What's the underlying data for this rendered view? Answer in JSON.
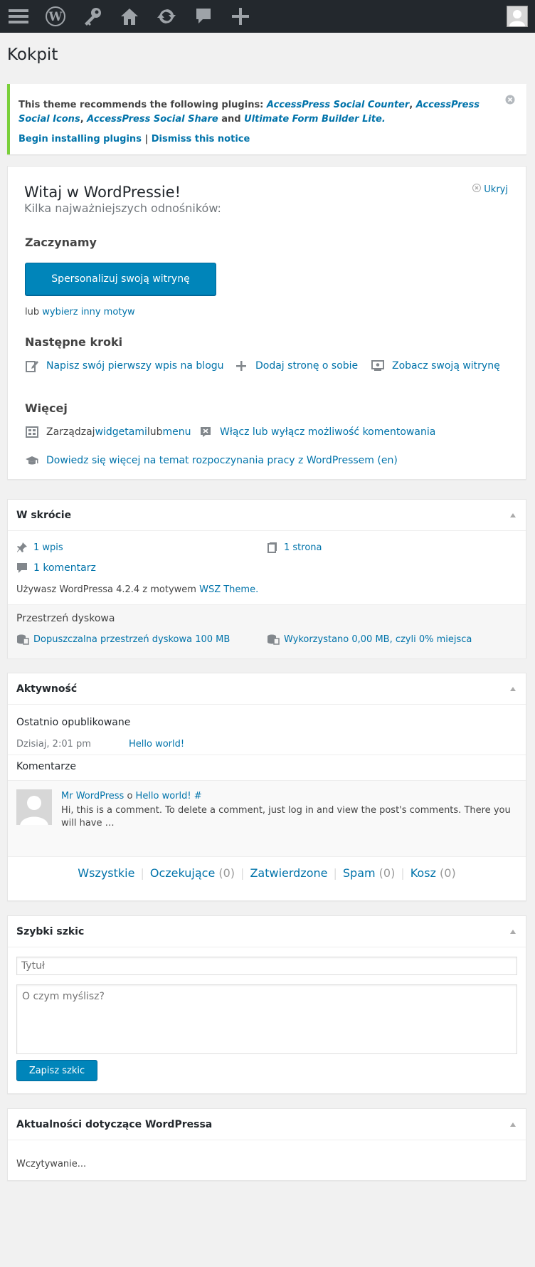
{
  "colors": {
    "adminbar": "#23282d",
    "accent": "#0073aa",
    "primary_button": "#0085ba",
    "notice_border": "#7ad03a"
  },
  "adminbar": {
    "items": [
      "menu-icon",
      "wordpress-logo-icon",
      "key-icon",
      "home-icon",
      "updates-icon",
      "comments-icon",
      "plus-icon"
    ],
    "avatar": "user-avatar"
  },
  "page": {
    "title": "Kokpit"
  },
  "notice": {
    "text_prefix": "This theme recommends the following plugins: ",
    "plugins": [
      "AccessPress Social Counter",
      "AccessPress Social Icons",
      "AccessPress Social Share",
      "Ultimate Form Builder Lite."
    ],
    "sep_comma": ", ",
    "and": " and ",
    "install_link": "Begin installing plugins",
    "divider": " | ",
    "dismiss_link": "Dismiss this notice"
  },
  "welcome": {
    "title": "Witaj w WordPressie!",
    "about": "Kilka najważniejszych odnośników:",
    "dismiss": "Ukryj",
    "get_started": "Zaczynamy",
    "customize_button": "Spersonalizuj swoją witrynę",
    "or": "lub ",
    "choose_theme": "wybierz inny motyw",
    "next_steps": "Następne kroki",
    "write_post": "Napisz swój pierwszy wpis na blogu",
    "add_about": "Dodaj stronę o sobie",
    "view_site": "Zobacz swoją witrynę",
    "more": "Więcej",
    "manage": "Zarządzaj ",
    "widgets": "widgetami",
    "or_word": " lub ",
    "menus": "menu",
    "comments_toggle": "Włącz lub wyłącz możliwość komentowania",
    "learn_more": "Dowiedz się więcej na temat rozpoczynania pracy z WordPressem (en)"
  },
  "glance": {
    "title": "W skrócie",
    "posts": "1 wpis",
    "pages": "1 strona",
    "comments": "1 komentarz",
    "version_text": "Używasz WordPressa 4.2.4 z motywem ",
    "theme_link": "WSZ Theme.",
    "disk_title": "Przestrzeń dyskowa",
    "disk_allowed": "Dopuszczalna przestrzeń dyskowa 100 MB",
    "disk_used": "Wykorzystano 0,00 MB, czyli 0% miejsca"
  },
  "activity": {
    "title": "Aktywność",
    "recent_title": "Ostatnio opublikowane",
    "recent_date": "Dzisiaj, 2:01 pm",
    "recent_post": "Hello world!",
    "comments_title": "Komentarze",
    "comment_author": "Mr WordPress",
    "comment_on": " o ",
    "comment_post": "Hello world! #",
    "comment_text": "Hi, this is a comment. To delete a comment, just log in and view the post's comments. There you will have …",
    "filters": [
      {
        "label": "Wszystkie",
        "count": ""
      },
      {
        "label": "Oczekujące",
        "count": "(0)"
      },
      {
        "label": "Zatwierdzone",
        "count": ""
      },
      {
        "label": "Spam",
        "count": "(0)"
      },
      {
        "label": "Kosz",
        "count": "(0)"
      }
    ],
    "sep": "|"
  },
  "draft": {
    "title": "Szybki szkic",
    "title_placeholder": "Tytuł",
    "content_placeholder": "O czym myślisz?",
    "save_button": "Zapisz szkic"
  },
  "news": {
    "title": "Aktualności dotyczące WordPressa",
    "loading": "Wczytywanie..."
  }
}
